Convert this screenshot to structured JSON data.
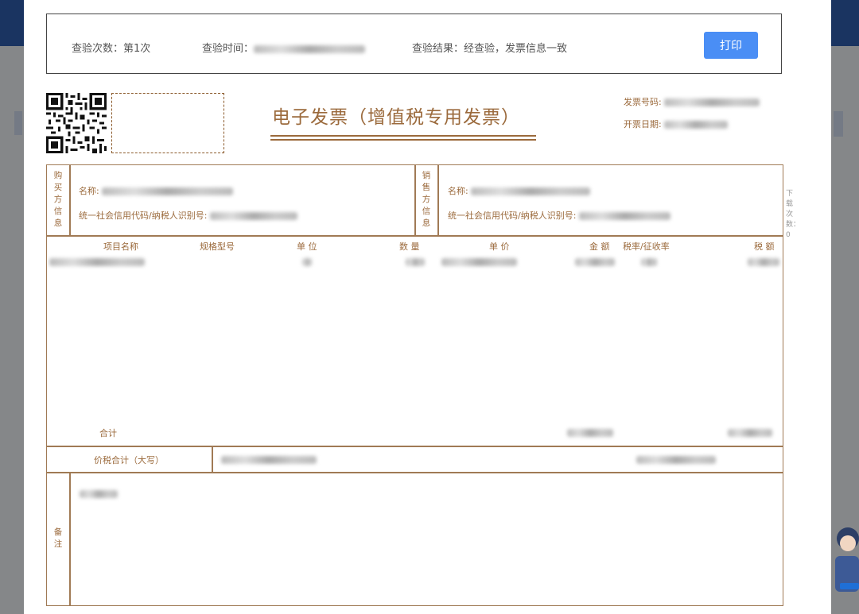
{
  "check_bar": {
    "count_label": "查验次数：",
    "count_value": "第1次",
    "time_label": "查验时间：",
    "result_label": "查验结果：",
    "result_value": "经查验，发票信息一致",
    "print_button": "打印"
  },
  "invoice": {
    "title": "电子发票（增值税专用发票）",
    "number_label": "发票号码:",
    "date_label": "开票日期:",
    "buyer_section_label": "购买方信息",
    "seller_section_label": "销售方信息",
    "buyer_name_label": "名称:",
    "buyer_tax_label": "统一社会信用代码/纳税人识别号:",
    "seller_name_label": "名称:",
    "seller_tax_label": "统一社会信用代码/纳税人识别号:",
    "columns": [
      "项目名称",
      "规格型号",
      "单 位",
      "数 量",
      "单 价",
      "金 额",
      "税率/征收率",
      "税 额"
    ],
    "subtotal_label": "合计",
    "total_label": "价税合计（大写）",
    "remarks_label": "备注",
    "side_note": "下载次数：0"
  },
  "colors": {
    "invoice_brown": "#9b6a3c",
    "print_button_blue": "#4a8ef5"
  }
}
